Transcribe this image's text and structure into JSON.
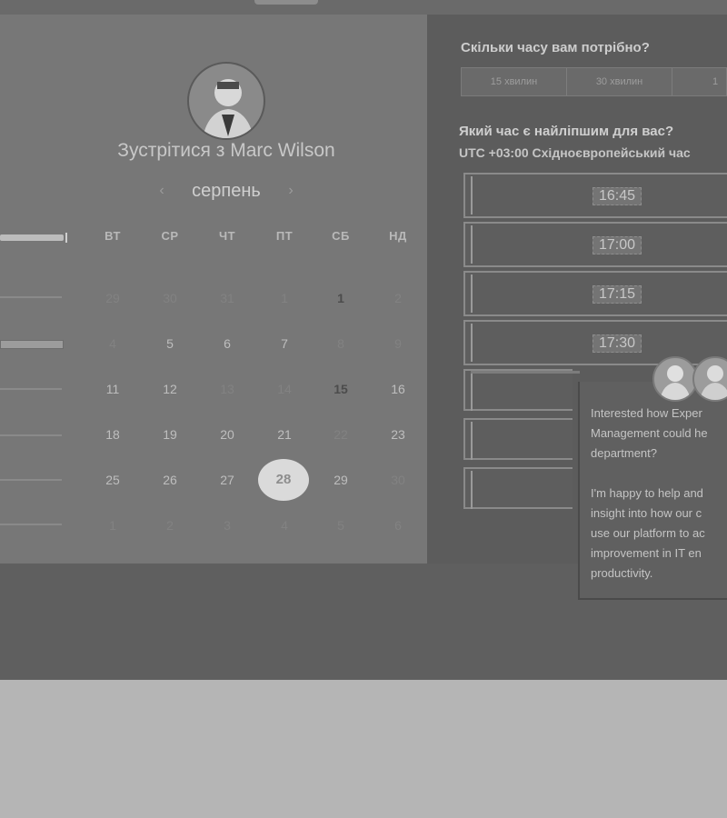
{
  "calendar": {
    "title": "Зустрітися з Marc Wilson",
    "month": "серпень",
    "prev_label": "‹",
    "next_label": "›",
    "weekdays": [
      "ВТ",
      "СР",
      "ЧТ",
      "ПТ",
      "СБ",
      "НД"
    ],
    "rows": [
      [
        "29",
        "30",
        "31",
        "1",
        "1",
        "2"
      ],
      [
        "4",
        "5",
        "6",
        "7",
        "8",
        "9"
      ],
      [
        "11",
        "12",
        "13",
        "14",
        "15",
        "16"
      ],
      [
        "18",
        "19",
        "20",
        "21",
        "22",
        "23"
      ],
      [
        "25",
        "26",
        "27",
        "28",
        "29",
        "30"
      ],
      [
        "1",
        "2",
        "3",
        "4",
        "5",
        "6"
      ]
    ],
    "selected_day": "28"
  },
  "booking": {
    "duration_question": "Скільки часу вам потрібно?",
    "durations": [
      "15 хвилин",
      "30 хвилин",
      "1"
    ],
    "time_question": "Який час є найліпшим для вас?",
    "timezone": "UTC +03:00 Східноєвропейський час",
    "slots": [
      "16:45",
      "17:00",
      "17:15",
      "17:30"
    ]
  },
  "chat": {
    "lines": [
      "Interested how Exper",
      "Management could he",
      "department?",
      "",
      "I'm happy to help and",
      "insight into how our c",
      "use our platform to ac",
      "improvement in IT en",
      "productivity."
    ]
  },
  "colors": {
    "panel_left": "#777777",
    "panel_right": "#5c5c5c",
    "selected_day_bg": "#dadada"
  }
}
